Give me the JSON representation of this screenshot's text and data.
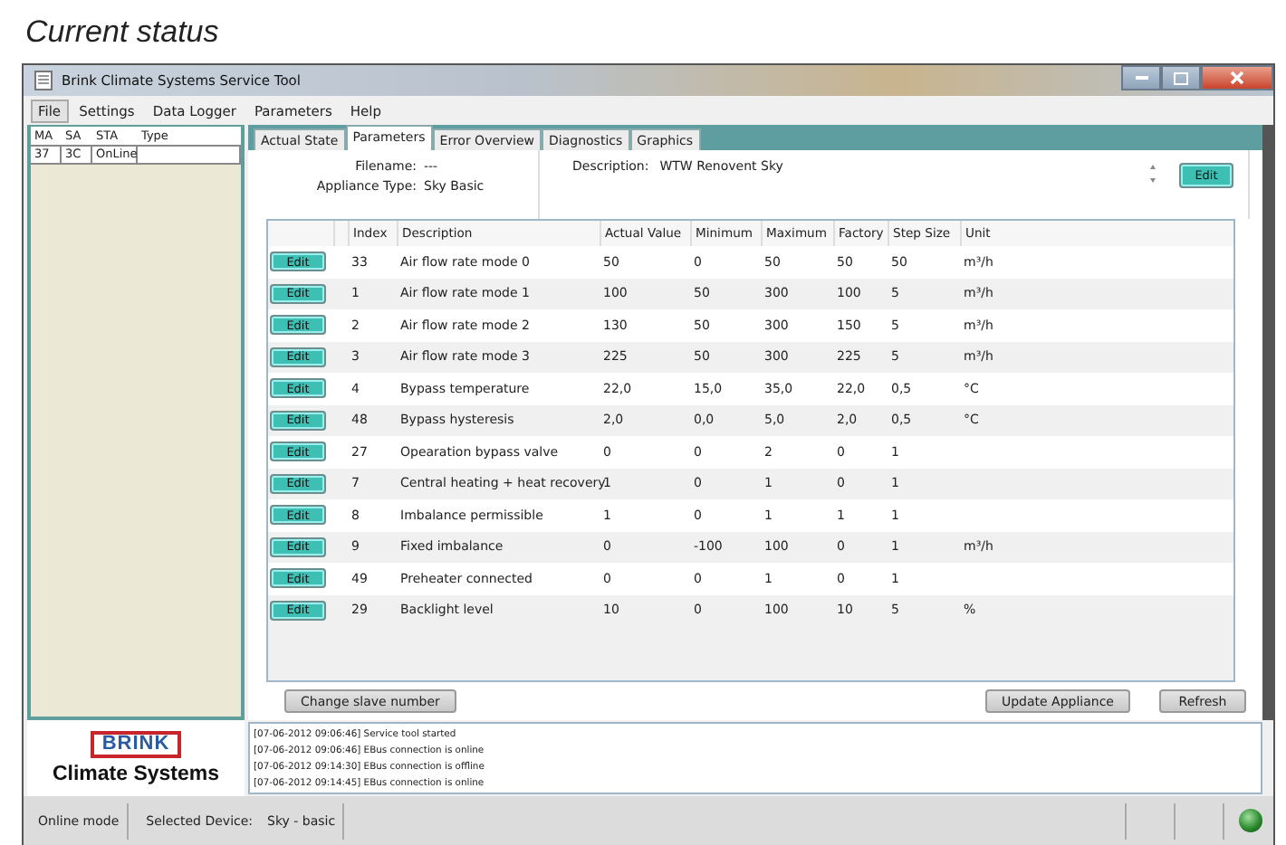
{
  "heading": "Current status",
  "window": {
    "title": "Brink Climate Systems Service Tool"
  },
  "menu": [
    {
      "label": "File",
      "selected": true
    },
    {
      "label": "Settings",
      "selected": false
    },
    {
      "label": "Data Logger",
      "selected": false
    },
    {
      "label": "Parameters",
      "selected": false
    },
    {
      "label": "Help",
      "selected": false
    }
  ],
  "device_list": {
    "columns": [
      "MA",
      "SA",
      "STA",
      "Type"
    ],
    "rows": [
      [
        "37",
        "3C",
        "OnLine"
      ]
    ]
  },
  "tabs": [
    {
      "label": "Actual State",
      "selected": false
    },
    {
      "label": "Parameters",
      "selected": true
    },
    {
      "label": "Error Overview",
      "selected": false
    },
    {
      "label": "Diagnostics",
      "selected": false
    },
    {
      "label": "Graphics",
      "selected": false
    }
  ],
  "info": {
    "filename_label": "Filename:",
    "filename": "---",
    "appliance_type_label": "Appliance Type:",
    "appliance_type": "Sky Basic",
    "description_label": "Description:",
    "description": "WTW Renovent Sky",
    "edit_button": "Edit"
  },
  "table": {
    "columns": [
      "Index",
      "Description",
      "Actual Value",
      "Minimum",
      "Maximum",
      "Factory",
      "Step Size",
      "Unit"
    ],
    "rows": [
      {
        "button": "Edit",
        "cells": [
          "33",
          "Air flow rate mode 0",
          "50",
          "0",
          "50",
          "50",
          "50",
          "m³/h"
        ]
      },
      {
        "button": "Edit",
        "cells": [
          "1",
          "Air flow rate mode 1",
          "100",
          "50",
          "300",
          "100",
          "5",
          "m³/h"
        ]
      },
      {
        "button": "Edit",
        "cells": [
          "2",
          "Air flow rate mode 2",
          "130",
          "50",
          "300",
          "150",
          "5",
          "m³/h"
        ]
      },
      {
        "button": "Edit",
        "cells": [
          "3",
          "Air flow rate mode 3",
          "225",
          "50",
          "300",
          "225",
          "5",
          "m³/h"
        ]
      },
      {
        "button": "Edit",
        "cells": [
          "4",
          "Bypass temperature",
          "22,0",
          "15,0",
          "35,0",
          "22,0",
          "0,5",
          "°C"
        ]
      },
      {
        "button": "Edit",
        "cells": [
          "48",
          "Bypass hysteresis",
          "2,0",
          "0,0",
          "5,0",
          "2,0",
          "0,5",
          "°C"
        ]
      },
      {
        "button": "Edit",
        "cells": [
          "27",
          "Opearation bypass valve",
          "0",
          "0",
          "2",
          "0",
          "1"
        ]
      },
      {
        "button": "Edit",
        "cells": [
          "7",
          "Central heating + heat recovery",
          "1",
          "0",
          "1",
          "0",
          "1"
        ]
      },
      {
        "button": "Edit",
        "cells": [
          "8",
          "Imbalance permissible",
          "1",
          "0",
          "1",
          "1",
          "1"
        ]
      },
      {
        "button": "Edit",
        "cells": [
          "9",
          "Fixed imbalance",
          "0",
          "-100",
          "100",
          "0",
          "1",
          "m³/h"
        ]
      },
      {
        "button": "Edit",
        "cells": [
          "49",
          "Preheater connected",
          "0",
          "0",
          "1",
          "0",
          "1"
        ]
      },
      {
        "button": "Edit",
        "cells": [
          "29",
          "Backlight level",
          "10",
          "0",
          "100",
          "10",
          "5",
          "%"
        ]
      }
    ]
  },
  "actions": {
    "change_slave": "Change slave number",
    "update": "Update Appliance",
    "refresh": "Refresh"
  },
  "logo": {
    "brand": "BRINK",
    "tagline": "Climate Systems"
  },
  "log": [
    "[07-06-2012 09:06:46]  Service tool started",
    "[07-06-2012 09:06:46]  EBus connection is online",
    "[07-06-2012 09:14:30]  EBus connection is offline",
    "[07-06-2012 09:14:45]  EBus connection is online"
  ],
  "status_bar": {
    "mode": "Online mode",
    "device_label": "Selected Device:",
    "device": "Sky - basic",
    "connected": true
  }
}
